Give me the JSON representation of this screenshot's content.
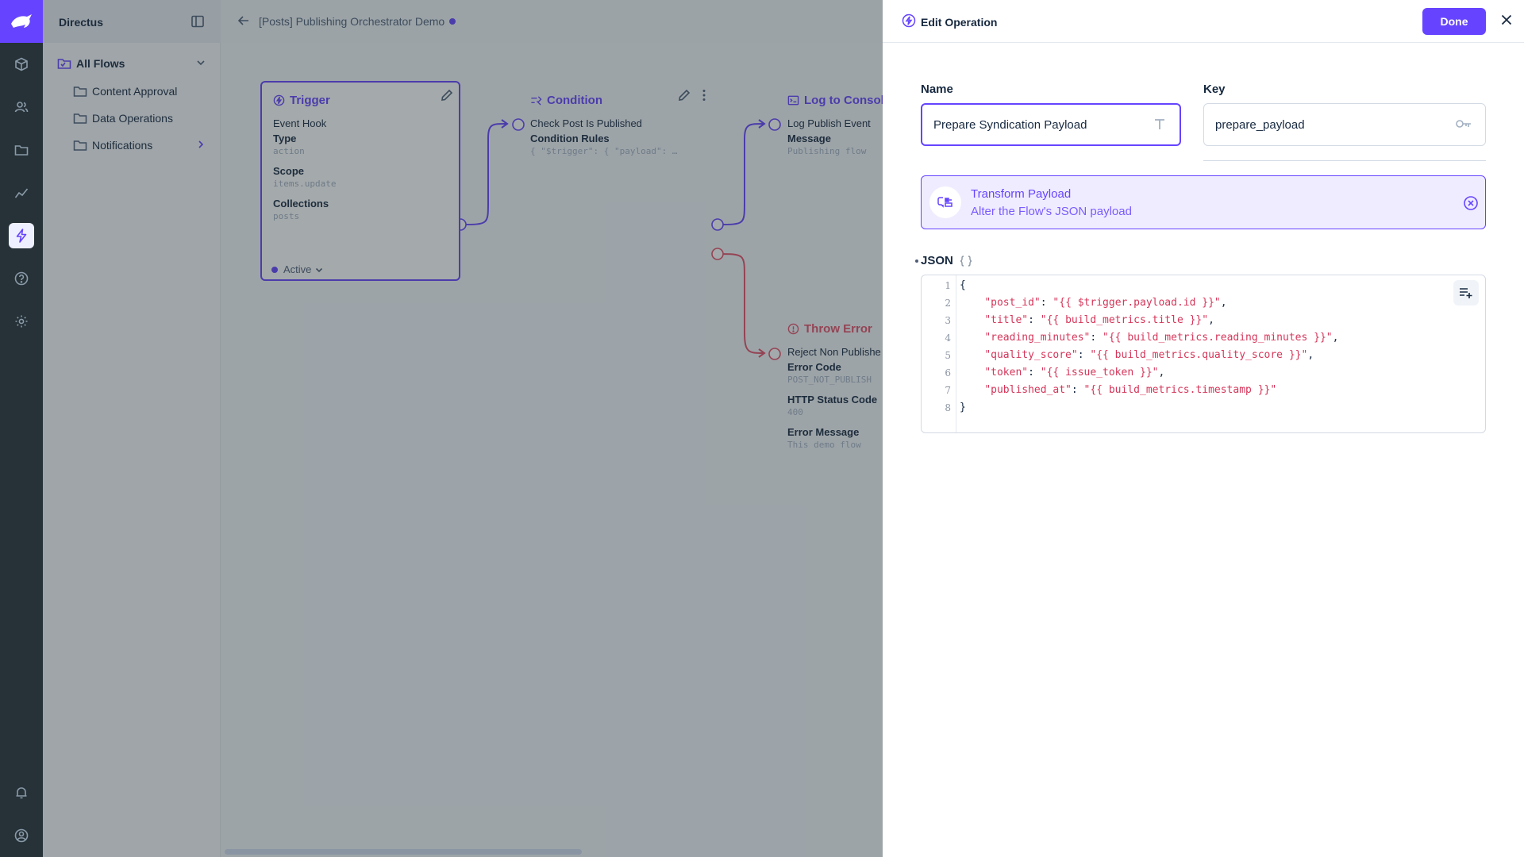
{
  "app": {
    "nav_title": "Directus"
  },
  "nav": {
    "all_flows": "All Flows",
    "folders": [
      {
        "label": "Content Approval"
      },
      {
        "label": "Data Operations"
      },
      {
        "label": "Notifications"
      }
    ]
  },
  "header": {
    "flow_title": "[Posts] Publishing Orchestrator Demo"
  },
  "canvas": {
    "trigger": {
      "title": "Trigger",
      "subtitle": "Event Hook",
      "fields": [
        {
          "label": "Type",
          "value": "action"
        },
        {
          "label": "Scope",
          "value": "items.update"
        },
        {
          "label": "Collections",
          "value": "posts"
        }
      ],
      "status": "Active"
    },
    "condition": {
      "title": "Condition",
      "subtitle": "Check Post Is Published",
      "field_label": "Condition Rules",
      "field_value": "{ \"$trigger\": { \"payload\": …"
    },
    "log": {
      "title": "Log to Console",
      "subtitle": "Log Publish Event",
      "field_label": "Message",
      "field_value": "Publishing flow"
    },
    "throw": {
      "title": "Throw Error",
      "subtitle": "Reject Non Publishe",
      "fields": [
        {
          "label": "Error Code",
          "value": "POST_NOT_PUBLISH"
        },
        {
          "label": "HTTP Status Code",
          "value": "400"
        },
        {
          "label": "Error Message",
          "value": "This demo flow"
        }
      ]
    }
  },
  "drawer": {
    "title": "Edit Operation",
    "done_label": "Done",
    "name_label": "Name",
    "name_value": "Prepare Syndication Payload",
    "key_label": "Key",
    "key_value": "prepare_payload",
    "operation": {
      "name": "Transform Payload",
      "description": "Alter the Flow's JSON payload"
    },
    "json_label": "JSON",
    "code_lines": [
      {
        "num": "1",
        "key": "",
        "val": "",
        "text": "{"
      },
      {
        "num": "2",
        "key": "\"post_id\"",
        "val": "\"{{ $trigger.payload.id }}\"",
        "text": ","
      },
      {
        "num": "3",
        "key": "\"title\"",
        "val": "\"{{ build_metrics.title }}\"",
        "text": ","
      },
      {
        "num": "4",
        "key": "\"reading_minutes\"",
        "val": "\"{{ build_metrics.reading_minutes }}\"",
        "text": ","
      },
      {
        "num": "5",
        "key": "\"quality_score\"",
        "val": "\"{{ build_metrics.quality_score }}\"",
        "text": ","
      },
      {
        "num": "6",
        "key": "\"token\"",
        "val": "\"{{ issue_token }}\"",
        "text": ","
      },
      {
        "num": "7",
        "key": "\"published_at\"",
        "val": "\"{{ build_metrics.timestamp }}\"",
        "text": ""
      },
      {
        "num": "8",
        "key": "",
        "val": "",
        "text": "}"
      }
    ]
  },
  "icons": {
    "rail": [
      "directus-logo-icon",
      "box-icon",
      "users-icon",
      "folder-icon",
      "insights-icon",
      "flows-bolt-icon",
      "help-icon",
      "settings-icon",
      "bell-icon",
      "account-icon"
    ]
  },
  "colors": {
    "accent": "#6644ff",
    "accent_bg": "#f0ecff",
    "code_string": "#d5365a",
    "rail": "#263238"
  }
}
